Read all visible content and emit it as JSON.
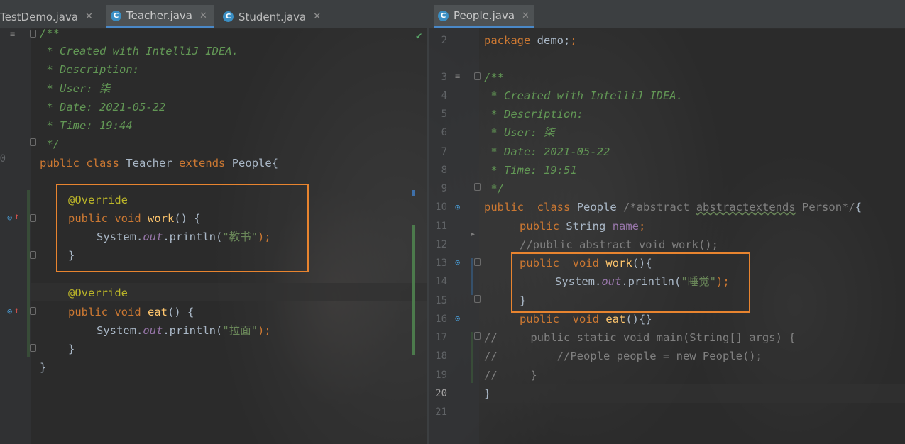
{
  "left_editor": {
    "tabs": [
      {
        "label": "TestDemo.java",
        "close": "✕"
      },
      {
        "label": "Teacher.java",
        "close": "✕"
      },
      {
        "label": "Student.java",
        "close": "✕"
      }
    ],
    "file_icon_letter": "C",
    "status_mark": "✔",
    "line_numbers": [
      "",
      "",
      "",
      "",
      "",
      "",
      "",
      "0",
      "",
      "",
      "",
      "",
      "",
      "",
      "",
      "",
      "",
      "",
      "",
      "",
      ""
    ],
    "lines": {
      "l1": "/**",
      "l2": " * Created with IntelliJ IDEA.",
      "l3": " * Description:",
      "l4": " * User: 柒",
      "l5": " * Date: 2021-05-22",
      "l6": " * Time: 19:44",
      "l7": " */",
      "l8_kw1": "public",
      "l8_kw2": "class",
      "l8_name": "Teacher",
      "l8_kw3": "extends",
      "l8_parent": "People{",
      "l10_ann": "@Override",
      "l11_kw1": "public",
      "l11_kw2": "void",
      "l11_fn": "work",
      "l11_rest": "() {",
      "l12_sys": "System.",
      "l12_out": "out",
      "l12_call": ".println(",
      "l12_str": "\"教书\"",
      "l12_end": ");",
      "l13": "}",
      "l15_ann": "@Override",
      "l16_kw1": "public",
      "l16_kw2": "void",
      "l16_fn": "eat",
      "l16_rest": "() {",
      "l17_sys": "System.",
      "l17_out": "out",
      "l17_call": ".println(",
      "l17_str": "\"拉面\"",
      "l17_end": ");",
      "l18": "}",
      "l19": "}"
    }
  },
  "right_editor": {
    "tab": {
      "label": "People.java",
      "close": "✕"
    },
    "file_icon_letter": "C",
    "line_numbers": [
      "2",
      "3",
      "4",
      "5",
      "6",
      "7",
      "8",
      "9",
      "10",
      "11",
      "12",
      "13",
      "14",
      "15",
      "16",
      "17",
      "18",
      "19",
      "20",
      "21"
    ],
    "lines": {
      "l2_kw": "package",
      "l2_rest": " demo;",
      "l3": "/**",
      "l4": " * Created with IntelliJ IDEA.",
      "l5": " * Description:",
      "l6": " * User: 柒",
      "l7": " * Date: 2021-05-22",
      "l8": " * Time: 19:51",
      "l9": " */",
      "l10_kw1": "public",
      "l10_kw2": "class",
      "l10_name": "People",
      "l10_c1": "/*abstract",
      "l10_c2": "abstractextends",
      "l10_c3": "Person*/",
      "l10_end": "{",
      "l11_kw": "public",
      "l11_type": "String",
      "l11_fld": "name",
      "l11_end": ";",
      "l12": "//public abstract void work();",
      "l13_kw1": "public",
      "l13_kw2": "void",
      "l13_fn": "work",
      "l13_rest": "(){",
      "l14_sys": "System.",
      "l14_out": "out",
      "l14_call": ".println(",
      "l14_str": "\"睡觉\"",
      "l14_end": ");",
      "l15": "}",
      "l16_kw1": "public",
      "l16_kw2": "void",
      "l16_fn": "eat",
      "l16_rest": "(){}",
      "l17": "//     public static void main(String[] args) {",
      "l18": "//         //People people = new People();",
      "l19": "//     }",
      "l20": "}"
    }
  },
  "colors": {
    "keyword": "#cc7832",
    "annotation": "#bbb529",
    "doc_comment": "#629755",
    "line_comment": "#808080",
    "string": "#6a8759",
    "method": "#ffc66d",
    "static_field": "#9876aa",
    "highlight_box": "#e8842f",
    "tab_underline": "#4a88c7"
  }
}
